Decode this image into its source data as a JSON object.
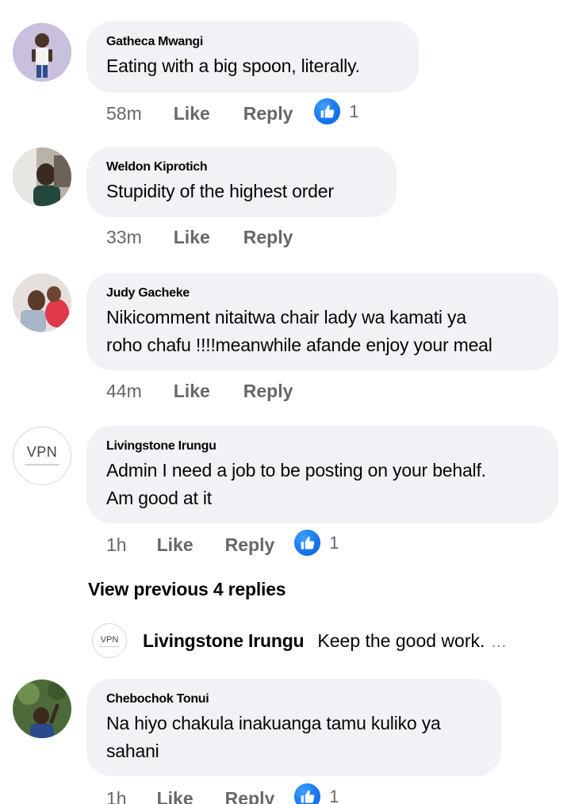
{
  "comments": [
    {
      "author": "Gatheca Mwangi",
      "text": "Eating with a big spoon, literally.",
      "time": "58m",
      "like_label": "Like",
      "reply_label": "Reply",
      "reaction_count": "1"
    },
    {
      "author": "Weldon Kiprotich",
      "text": "Stupidity of the highest order",
      "time": "33m",
      "like_label": "Like",
      "reply_label": "Reply"
    },
    {
      "author": "Judy Gacheke",
      "text": "Nikicomment nitaitwa chair lady wa kamati ya\nroho chafu !!!!meanwhile afande enjoy your meal",
      "time": "44m",
      "like_label": "Like",
      "reply_label": "Reply"
    },
    {
      "author": "Livingstone Irungu",
      "avatar_text": "VPN",
      "text": "Admin I need a job to be posting on your behalf.\nAm good at it",
      "time": "1h",
      "like_label": "Like",
      "reply_label": "Reply",
      "reaction_count": "1"
    },
    {
      "author": "Chebochok Tonui",
      "text": "Na hiyo chakula inakuanga tamu kuliko ya\nsahani",
      "time": "1h",
      "like_label": "Like",
      "reply_label": "Reply",
      "reaction_count": "1"
    }
  ],
  "view_previous_replies": "View previous 4 replies",
  "reply_preview": {
    "author": "Livingstone Irungu",
    "avatar_text": "VPN",
    "text": "Keep the good work.",
    "ellipsis": "..."
  },
  "colors": {
    "bubble": "#f0f2f5",
    "meta_text": "#65676b",
    "like_blue": "#1877f2"
  },
  "icons": {
    "reaction": "thumbs-up-icon"
  }
}
